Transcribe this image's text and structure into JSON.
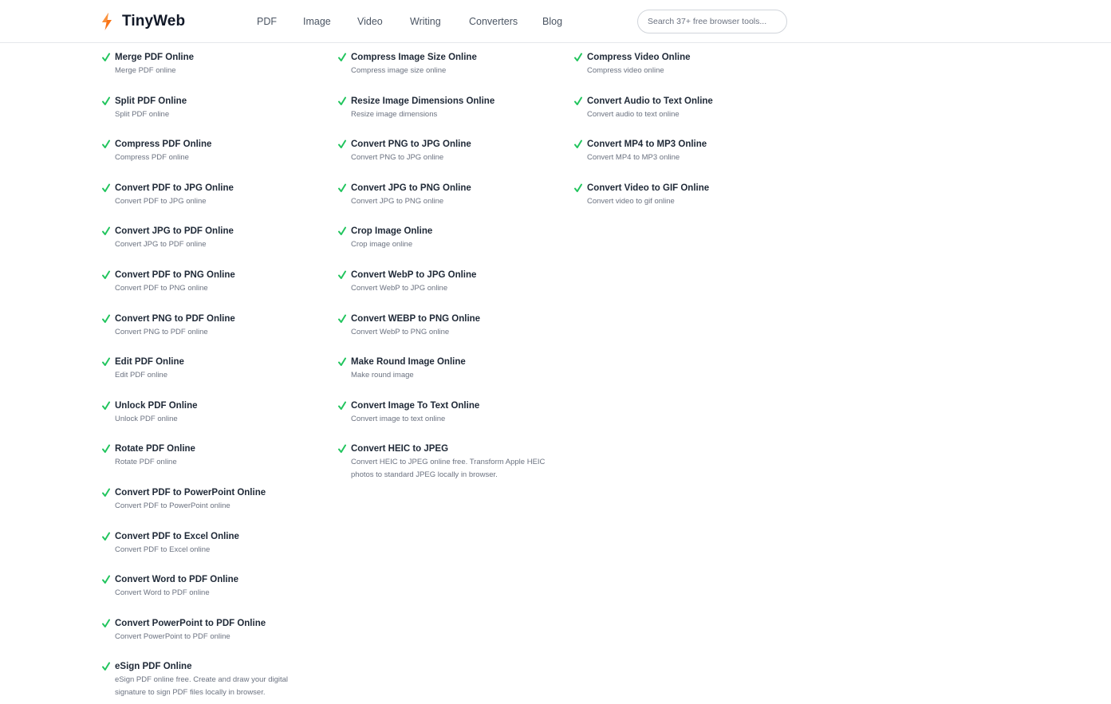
{
  "brand": {
    "name": "TinyWeb",
    "icon": "lightning-bolt-icon",
    "accent": "#f97316"
  },
  "nav": [
    {
      "label": "PDF"
    },
    {
      "label": "Image"
    },
    {
      "label": "Video"
    },
    {
      "label": "Writing"
    },
    {
      "label": "Converters"
    },
    {
      "label": "Blog"
    }
  ],
  "search": {
    "placeholder": "Search 37+ free browser tools...",
    "value": ""
  },
  "check_color": "#22c55e",
  "columns": [
    [
      {
        "title": "Merge PDF Online",
        "desc": "Merge PDF online"
      },
      {
        "title": "Split PDF Online",
        "desc": "Split PDF online"
      },
      {
        "title": "Compress PDF Online",
        "desc": "Compress PDF online"
      },
      {
        "title": "Convert PDF to JPG Online",
        "desc": "Convert PDF to JPG online"
      },
      {
        "title": "Convert JPG to PDF Online",
        "desc": "Convert JPG to PDF online"
      },
      {
        "title": "Convert PDF to PNG Online",
        "desc": "Convert PDF to PNG online"
      },
      {
        "title": "Convert PNG to PDF Online",
        "desc": "Convert PNG to PDF online"
      },
      {
        "title": "Edit PDF Online",
        "desc": "Edit PDF online"
      },
      {
        "title": "Unlock PDF Online",
        "desc": "Unlock PDF online"
      },
      {
        "title": "Rotate PDF Online",
        "desc": "Rotate PDF online"
      },
      {
        "title": "Convert PDF to PowerPoint Online",
        "desc": "Convert PDF to PowerPoint online"
      },
      {
        "title": "Convert PDF to Excel Online",
        "desc": "Convert PDF to Excel online"
      },
      {
        "title": "Convert Word to PDF Online",
        "desc": "Convert Word to PDF online"
      },
      {
        "title": "Convert PowerPoint to PDF Online",
        "desc": "Convert PowerPoint to PDF online"
      },
      {
        "title": "eSign PDF Online",
        "desc": "eSign PDF online free. Create and draw your digital signature to sign PDF files locally in browser."
      }
    ],
    [
      {
        "title": "Compress Image Size Online",
        "desc": "Compress image size online"
      },
      {
        "title": "Resize Image Dimensions Online",
        "desc": "Resize image dimensions"
      },
      {
        "title": "Convert PNG to JPG Online",
        "desc": "Convert PNG to JPG online"
      },
      {
        "title": "Convert JPG to PNG Online",
        "desc": "Convert JPG to PNG online"
      },
      {
        "title": "Crop Image Online",
        "desc": "Crop image online"
      },
      {
        "title": "Convert WebP to JPG Online",
        "desc": "Convert WebP to JPG online"
      },
      {
        "title": "Convert WEBP to PNG Online",
        "desc": "Convert WebP to PNG online"
      },
      {
        "title": "Make Round Image Online",
        "desc": "Make round image"
      },
      {
        "title": "Convert Image To Text Online",
        "desc": "Convert image to text online"
      },
      {
        "title": "Convert HEIC to JPEG",
        "desc": "Convert HEIC to JPEG online free. Transform Apple HEIC photos to standard JPEG locally in browser."
      }
    ],
    [
      {
        "title": "Compress Video Online",
        "desc": "Compress video online"
      },
      {
        "title": "Convert Audio to Text Online",
        "desc": "Convert audio to text online"
      },
      {
        "title": "Convert MP4 to MP3 Online",
        "desc": "Convert MP4 to MP3 online"
      },
      {
        "title": "Convert Video to GIF Online",
        "desc": "Convert video to gif online"
      }
    ]
  ]
}
